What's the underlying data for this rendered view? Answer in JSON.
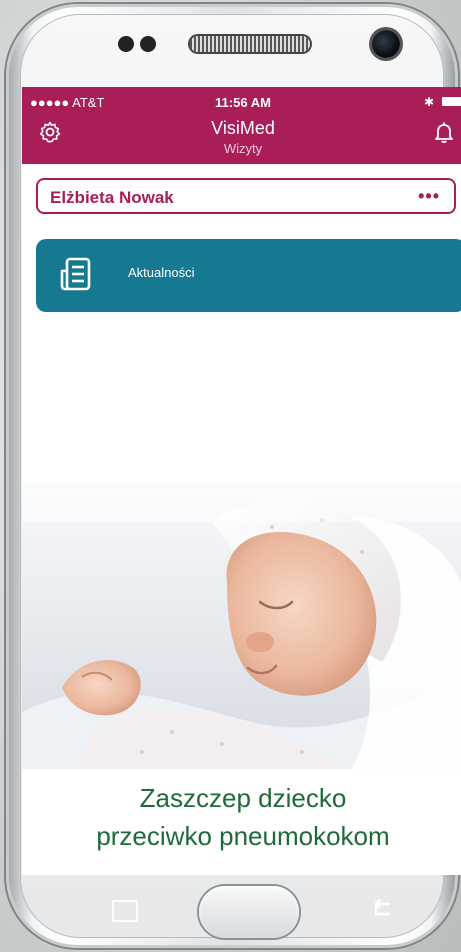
{
  "statusbar": {
    "carrier": "●●●●● AT&T",
    "time": "11:56 AM"
  },
  "header": {
    "title": "VisiMed",
    "subtitle": "Wizyty",
    "left_icon": "gear-icon",
    "right_icon": "bell-icon",
    "color": "#a91e59"
  },
  "user": {
    "name": "Elżbieta Nowak",
    "menu": "•••"
  },
  "news": {
    "label": "Aktualności",
    "icon": "news-icon",
    "color": "#157a91"
  },
  "promo": {
    "line1": "Zaszczep dziecko",
    "line2": "przeciwko pneumokokom",
    "color": "#1f6a3a"
  }
}
